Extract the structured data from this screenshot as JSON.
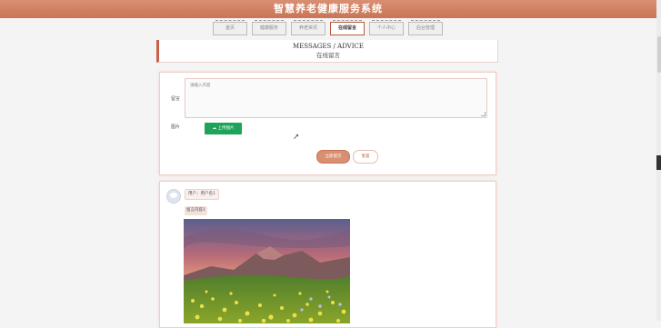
{
  "app": {
    "title": "智慧养老健康服务系统"
  },
  "nav": [
    {
      "label": "首页"
    },
    {
      "label": "健康服务"
    },
    {
      "label": "养老资讯"
    },
    {
      "label": "在线留言",
      "active": true
    },
    {
      "label": "个人中心"
    },
    {
      "label": "后台管理"
    }
  ],
  "page_title": {
    "en": "MESSAGES / ADVICE",
    "cn": "在线留言"
  },
  "form": {
    "message_label": "留言",
    "message_placeholder": "请输入内容",
    "image_label": "图片",
    "upload_label": "上传图片",
    "submit_label": "立即提交",
    "reset_label": "重置"
  },
  "messages": [
    {
      "user": "用户：用户名1",
      "content": "留言内容1"
    }
  ],
  "colors": {
    "brand": "#c97555",
    "upload": "#1fa25a"
  }
}
